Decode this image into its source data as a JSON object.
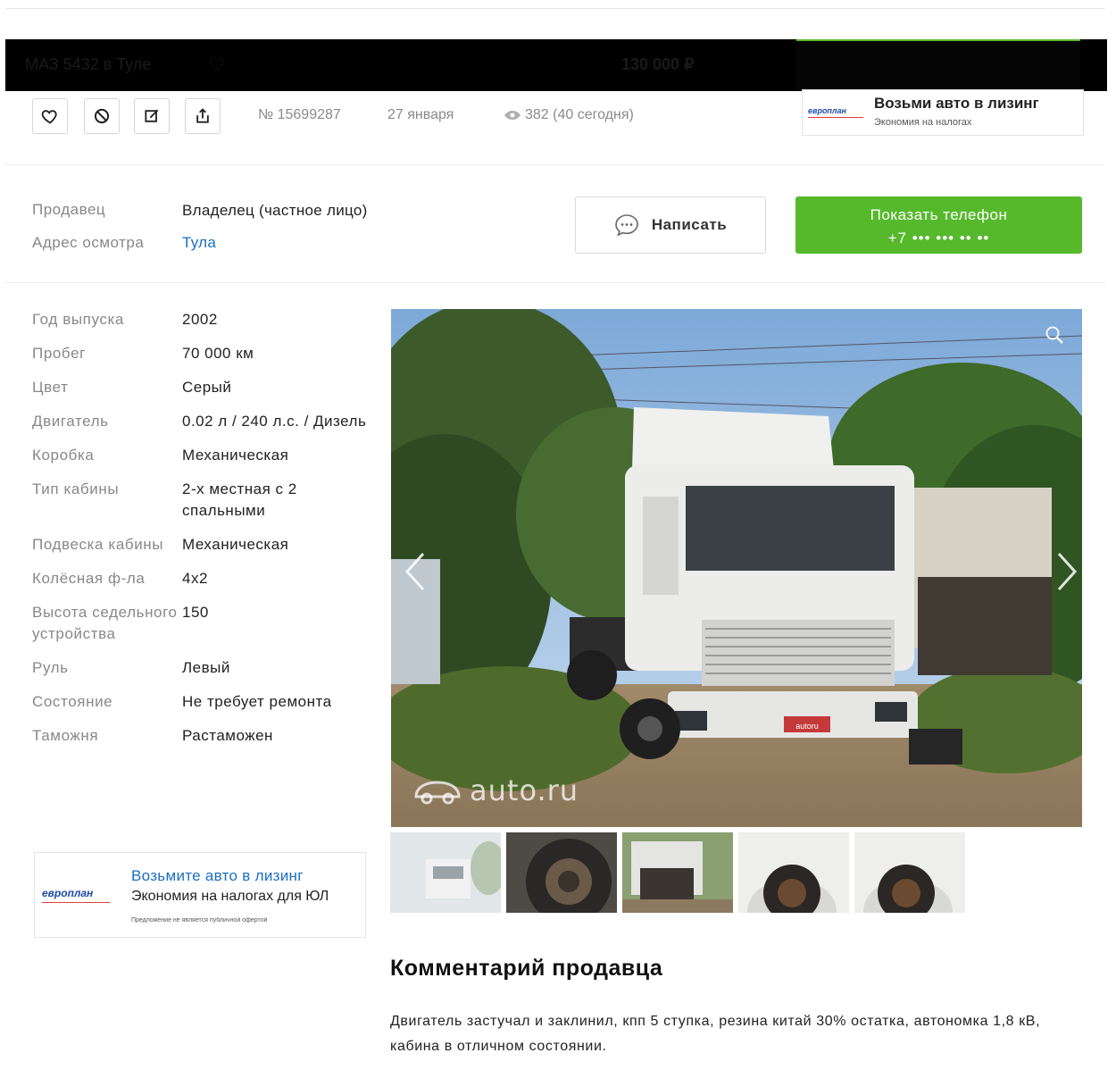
{
  "sticky": {
    "title": "МАЗ 5432 в Туле",
    "price": "130 000 ₽"
  },
  "actions": {
    "favorite_icon": "heart-icon",
    "block_icon": "ban-icon",
    "edit_icon": "edit-icon",
    "share_icon": "share-icon"
  },
  "meta": {
    "id": "№ 15699287",
    "date": "27 января",
    "views": "382 (40 сегодня)"
  },
  "lease_top": {
    "logo": "европлан",
    "title": "Возьми авто в лизинг",
    "subtitle": "Экономия на налогах"
  },
  "seller": {
    "seller_label": "Продавец",
    "seller_value": "Владелец (частное лицо)",
    "address_label": "Адрес осмотра",
    "address_value": "Тула",
    "write_label": "Написать",
    "phone_label": "Показать телефон",
    "phone_masked": "+7 ••• ••• •• ••"
  },
  "specs": [
    {
      "label": "Год выпуска",
      "value": "2002"
    },
    {
      "label": "Пробег",
      "value": "70 000 км"
    },
    {
      "label": "Цвет",
      "value": "Серый"
    },
    {
      "label": "Двигатель",
      "value": "0.02 л / 240 л.с. / Дизель"
    },
    {
      "label": "Коробка",
      "value": "Механическая"
    },
    {
      "label": "Тип кабины",
      "value": "2-х местная с 2 спальными"
    },
    {
      "label": "Подвеска кабины",
      "value": "Механическая"
    },
    {
      "label": "Колёсная ф-ла",
      "value": "4x2"
    },
    {
      "label": "Высота седельного устройства",
      "value": "150"
    },
    {
      "label": "Руль",
      "value": "Левый"
    },
    {
      "label": "Состояние",
      "value": "Не требует ремонта"
    },
    {
      "label": "Таможня",
      "value": "Растаможен"
    }
  ],
  "lease_side": {
    "logo": "европлан",
    "title": "Возьмите авто в лизинг",
    "subtitle": "Экономия на налогах для ЮЛ",
    "fineprint": "Предложение не является публичной офертой"
  },
  "gallery": {
    "watermark": "auto.ru",
    "plate": "autoru",
    "thumb_count": 5
  },
  "comment": {
    "title": "Комментарий продавца",
    "text": "Двигатель застучал и заклинил, кпп 5 ступка, резина китай 30% остатка, автономка 1,8 кВ, кабина в отличном состоянии."
  }
}
